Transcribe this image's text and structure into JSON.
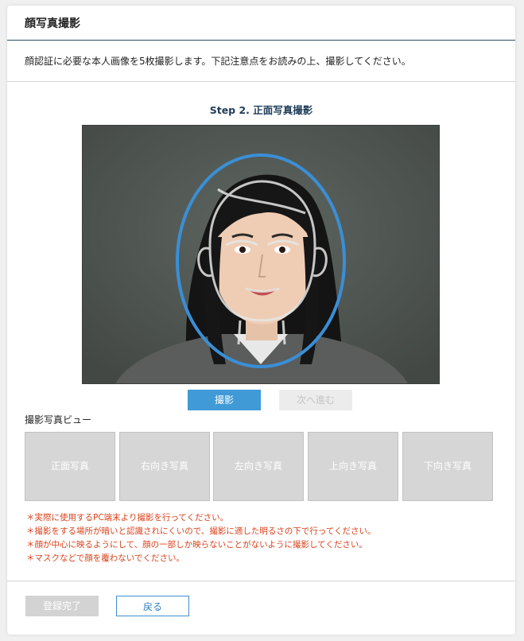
{
  "header": {
    "title": "顔写真撮影"
  },
  "intro": {
    "text": "顔認証に必要な本人画像を5枚撮影します。下記注意点をお読みの上、撮影してください。"
  },
  "step": {
    "title": "Step 2. 正面写真撮影"
  },
  "camera": {
    "guide_color": "#3a8fd6"
  },
  "actions": {
    "capture_label": "撮影",
    "next_label": "次へ進む"
  },
  "preview": {
    "label": "撮影写真ビュー",
    "thumbnails": [
      "正面写真",
      "右向き写真",
      "左向き写真",
      "上向き写真",
      "下向き写真"
    ]
  },
  "notes": [
    "＊実際に使用するPC端末より撮影を行ってください。",
    "＊撮影をする場所が暗いと認識されにくいので、撮影に適した明るさの下で行ってください。",
    "＊顔が中心に映るようにして、顔の一部しか映らないことがないように撮影してください。",
    "＊マスクなどで顔を覆わないでください。"
  ],
  "footer": {
    "done_label": "登録完了",
    "back_label": "戻る"
  },
  "colors": {
    "accent": "#3f9ad6",
    "header_rule": "#2e4d63",
    "note_text": "#d9411b"
  }
}
